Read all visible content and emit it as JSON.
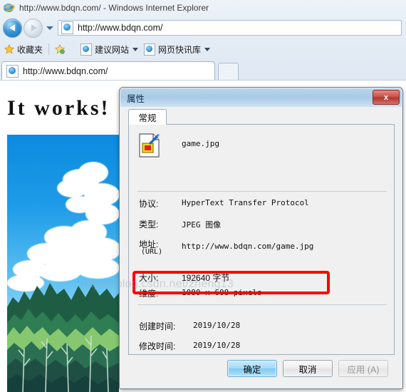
{
  "browser": {
    "window_title": "http://www.bdqn.com/ - Windows Internet Explorer",
    "address_value": "http://www.bdqn.com/",
    "favorites_label": "收藏夹",
    "favorites_items": [
      {
        "label": "建议网站"
      },
      {
        "label": "网页快讯库"
      }
    ],
    "tab_title": "http://www.bdqn.com/"
  },
  "page": {
    "heading": "It works!"
  },
  "dialog": {
    "title": "属性",
    "close_label": "x",
    "tab_label": "常规",
    "file_name": "game.jpg",
    "fields": [
      {
        "label": "协议:",
        "value": "HyperText Transfer Protocol"
      },
      {
        "label": "类型:",
        "value": "JPEG 图像"
      },
      {
        "label": "地址:",
        "sublabel": "(URL)",
        "value": "http://www.bdqn.com/game.jpg"
      },
      {
        "label": "大小:",
        "value": "192640 字节"
      },
      {
        "label": "维度:",
        "value": "1080  x  608  pixels"
      },
      {
        "label": "创建时间:",
        "value": "2019/10/28"
      },
      {
        "label": "修改时间:",
        "value": "2019/10/28"
      }
    ],
    "buttons": {
      "ok": "确定",
      "cancel": "取消",
      "apply": "应用 (A)"
    },
    "highlight_color": "#fe0000"
  },
  "watermark": {
    "text": "https://blog.csdn.net/zheng13"
  }
}
